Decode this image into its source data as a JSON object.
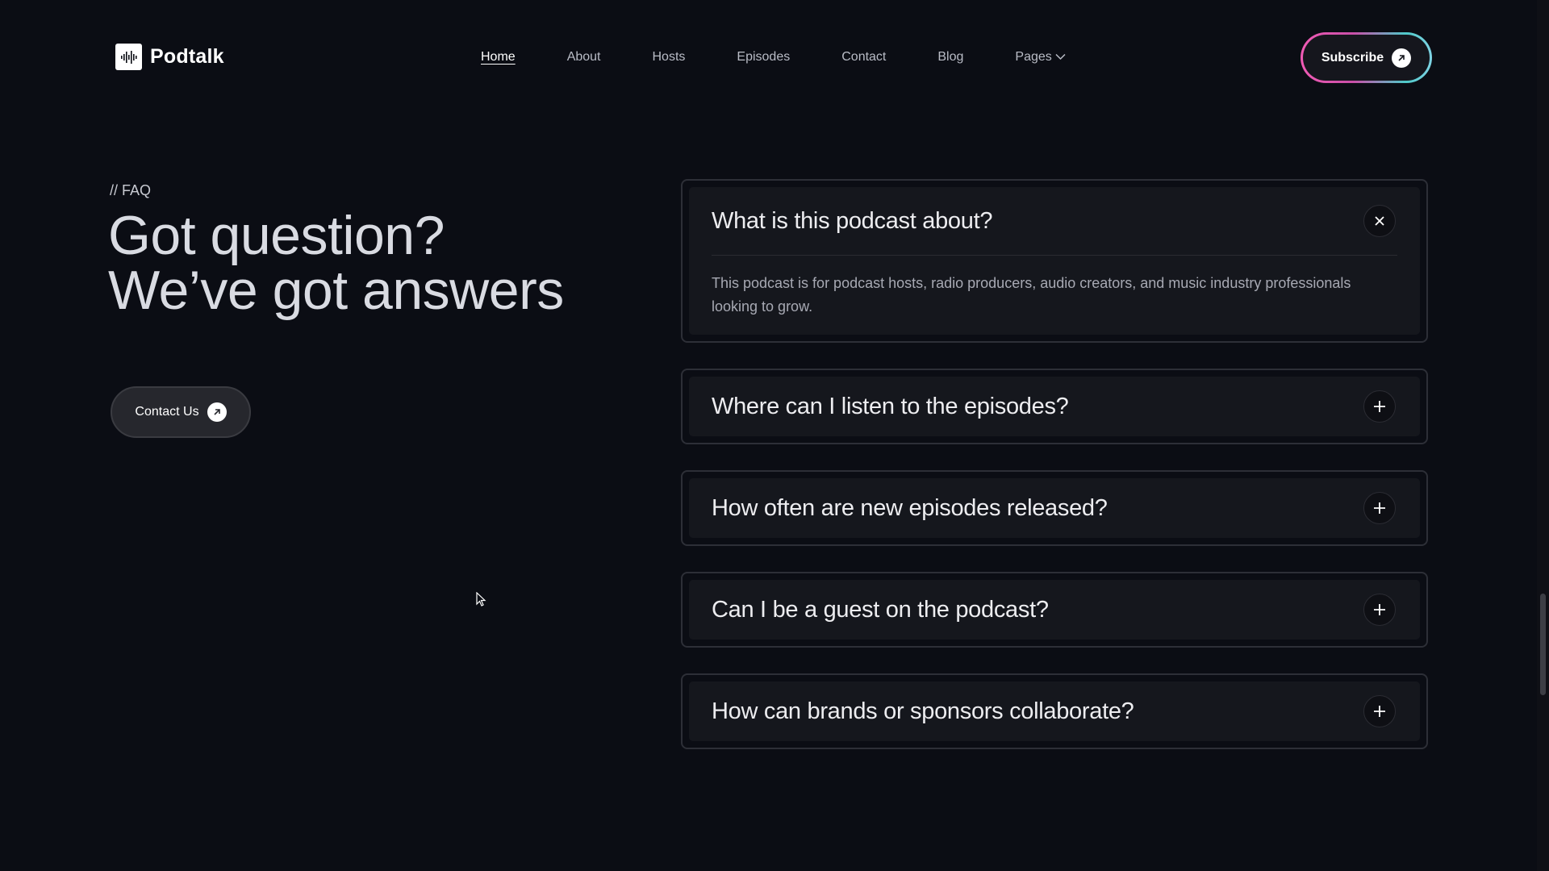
{
  "brand": {
    "name": "Podtalk",
    "icon": "waveform-icon"
  },
  "nav": {
    "items": [
      {
        "label": "Home",
        "active": true
      },
      {
        "label": "About",
        "active": false
      },
      {
        "label": "Hosts",
        "active": false
      },
      {
        "label": "Episodes",
        "active": false
      },
      {
        "label": "Contact",
        "active": false
      },
      {
        "label": "Blog",
        "active": false
      },
      {
        "label": "Pages",
        "active": false,
        "icon": "chevron-down-icon"
      }
    ],
    "subscribe_label": "Subscribe"
  },
  "faq_section": {
    "tag": "// FAQ",
    "heading_line1": "Got question?",
    "heading_line2": "We’ve got answers",
    "contact_label": "Contact Us"
  },
  "faqs": [
    {
      "question": "What is this podcast about?",
      "answer": "This podcast is for podcast hosts, radio producers, audio creators, and music industry professionals looking to grow.",
      "open": true,
      "toggle_icon": "close-icon"
    },
    {
      "question": "Where can I listen to the episodes?",
      "open": false,
      "toggle_icon": "plus-icon"
    },
    {
      "question": "How often are new episodes released?",
      "open": false,
      "toggle_icon": "plus-icon"
    },
    {
      "question": "Can I be a guest on the podcast?",
      "open": false,
      "toggle_icon": "plus-icon"
    },
    {
      "question": "How can brands or sponsors collaborate?",
      "open": false,
      "toggle_icon": "plus-icon"
    }
  ],
  "colors": {
    "background": "#0b0d14",
    "card": "#15171d",
    "subscribe_gradient": [
      "#f15bb5",
      "#4ec9c9"
    ]
  }
}
